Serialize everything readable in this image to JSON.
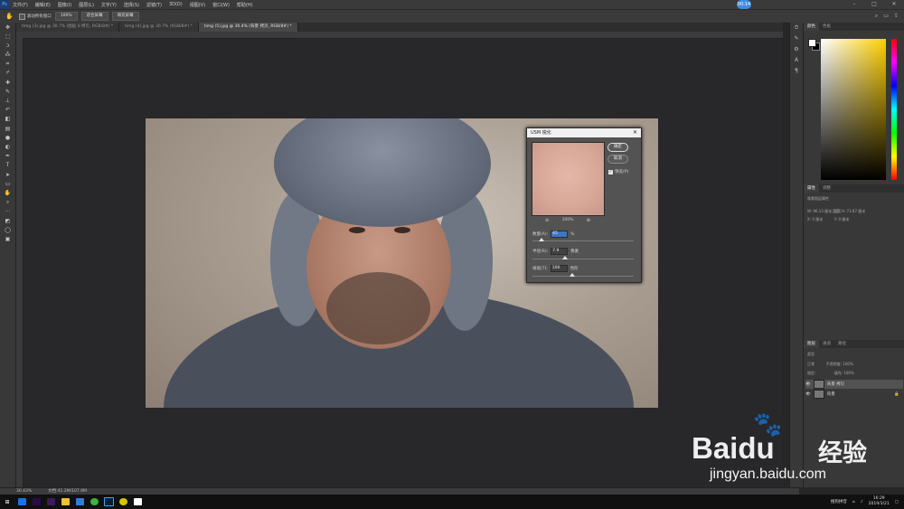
{
  "menubar": {
    "app_logo": "Ps",
    "items": [
      "文件(F)",
      "编辑(E)",
      "图像(I)",
      "图层(L)",
      "文字(Y)",
      "选择(S)",
      "滤镜(T)",
      "3D(D)",
      "视图(V)",
      "窗口(W)",
      "帮助(H)"
    ],
    "badge": "00:14"
  },
  "options": {
    "btn1": "滚动所有窗口",
    "btn2": "100%",
    "btn3": "适合屏幕",
    "btn4": "填充屏幕"
  },
  "tabs": [
    {
      "label": "timg (3).jpg @ 30.7% (图层 0 拷贝, RGB/8#) *",
      "active": false
    },
    {
      "label": "timg (4).jpg @ 30.7% (RGB/8#) *",
      "active": false
    },
    {
      "label": "timg (5).jpg @ 30.4% (背景 拷贝, RGB/8#) *",
      "active": true
    }
  ],
  "dialog": {
    "title": "USM 锐化",
    "ok": "确定",
    "cancel": "取消",
    "preview_label": "预览(P)",
    "zoom": "100%",
    "amount_label": "数量(A):",
    "amount_value": "45",
    "amount_unit": "%",
    "amount_level": 0.09,
    "radius_label": "半径(R):",
    "radius_value": "7.9",
    "radius_unit": "像素",
    "radius_level": 0.32,
    "threshold_label": "阈值(T):",
    "threshold_value": "100",
    "threshold_unit": "色阶",
    "threshold_level": 0.39
  },
  "right_panel": {
    "color_tab": "颜色",
    "swatches_tab": "色板",
    "props_tab1": "属性",
    "props_tab2": "调整",
    "props_title": "像素图层属性",
    "w_label": "W:",
    "w_value": "96.13 厘米",
    "go_label": "GO",
    "h_label": "H:",
    "h_value": "73.87 厘米",
    "x_label": "X:",
    "x_value": "0 厘米",
    "y_label": "Y:",
    "y_value": "0 厘米",
    "layers_tab": "图层",
    "channels_tab": "通道",
    "paths_tab": "路径",
    "kind": "类型",
    "mode": "正常",
    "opacity": "不透明度: 100%",
    "lock": "锁定:",
    "fill": "填充: 100%",
    "layers": [
      {
        "name": "背景 拷贝",
        "selected": true
      },
      {
        "name": "背景",
        "selected": false
      }
    ]
  },
  "status": {
    "zoom": "30.43%",
    "doc": "文档:41.2M/107.9M"
  },
  "taskbar": {
    "clock_time": "16:29",
    "clock_date": "2019/3/21",
    "ime": "搜狗拼音"
  },
  "watermark": {
    "brand": "Bai",
    "brand_du": "du",
    "cn": "经验",
    "url": "jingyan.baidu.com"
  },
  "colors": {
    "accent": "#3b78c2",
    "ui_dark": "#383838"
  }
}
